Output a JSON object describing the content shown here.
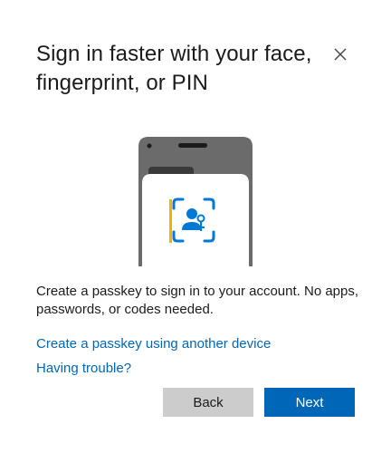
{
  "dialog": {
    "title": "Sign in faster with your face, fingerprint, or PIN",
    "description": "Create a passkey to sign in to your account. No apps, passwords, or codes needed.",
    "links": {
      "other_device": "Create a passkey using another device",
      "trouble": "Having trouble?"
    },
    "buttons": {
      "back": "Back",
      "next": "Next"
    },
    "icons": {
      "close": "close-icon",
      "phone": "phone-illustration",
      "passkey": "passkey-face-scan-icon"
    },
    "colors": {
      "accent": "#0067b8",
      "secondary_button": "#cccccc",
      "phone_body": "#6b6b6b",
      "passkey_icon": "#0078d4",
      "indicator": "#f2b200"
    }
  }
}
